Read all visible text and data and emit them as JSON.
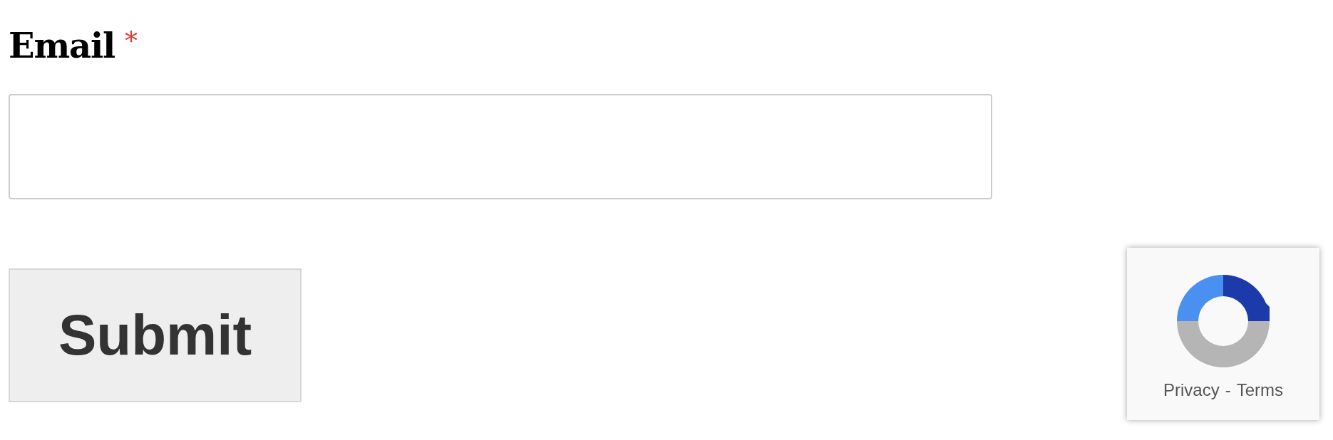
{
  "form": {
    "label": "Email",
    "required_mark": "*",
    "submit": "Submit"
  },
  "badge": {
    "links": [
      "Privacy",
      "Terms"
    ],
    "separator": "-"
  }
}
